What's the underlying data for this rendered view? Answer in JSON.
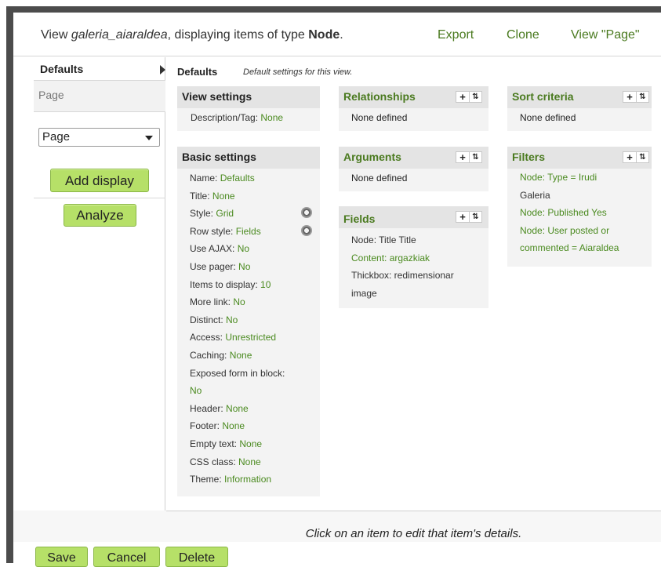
{
  "header": {
    "title_prefix": "View ",
    "view_name": "galeria_aiaraldea",
    "title_middle": ", displaying items of type ",
    "item_type": "Node",
    "title_suffix": ".",
    "links": {
      "export": "Export",
      "clone": "Clone",
      "view_page": "View \"Page\""
    }
  },
  "sidebar": {
    "tabs": {
      "defaults": "Defaults",
      "page": "Page"
    },
    "display_select": {
      "value": "Page"
    },
    "add_display_label": "Add display",
    "analyze_label": "Analyze"
  },
  "main": {
    "breadcrumb": {
      "title": "Defaults",
      "subtitle": "Default settings for this view."
    },
    "view_settings": {
      "title": "View settings",
      "items": [
        {
          "label": "Description/Tag: ",
          "value": "None"
        }
      ]
    },
    "basic_settings": {
      "title": "Basic settings",
      "items": [
        {
          "label": "Name: ",
          "value": "Defaults"
        },
        {
          "label": "Title: ",
          "value": "None"
        },
        {
          "label": "Style: ",
          "value": "Grid"
        },
        {
          "label": "Row style: ",
          "value": "Fields"
        },
        {
          "label": "Use AJAX: ",
          "value": "No"
        },
        {
          "label": "Use pager: ",
          "value": "No"
        },
        {
          "label": "Items to display: ",
          "value": "10"
        },
        {
          "label": "More link: ",
          "value": "No"
        },
        {
          "label": "Distinct: ",
          "value": "No"
        },
        {
          "label": "Access: ",
          "value": "Unrestricted"
        },
        {
          "label": "Caching: ",
          "value": "None"
        },
        {
          "label": "Exposed form in block:",
          "value": ""
        },
        {
          "label": "",
          "value": "No"
        },
        {
          "label": "Header: ",
          "value": "None"
        },
        {
          "label": "Footer: ",
          "value": "None"
        },
        {
          "label": "Empty text: ",
          "value": "None"
        },
        {
          "label": "CSS class: ",
          "value": "None"
        },
        {
          "label": "Theme: ",
          "value": "Information"
        }
      ]
    },
    "relationships": {
      "title": "Relationships",
      "items": [
        "None defined"
      ]
    },
    "arguments": {
      "title": "Arguments",
      "items": [
        "None defined"
      ]
    },
    "fields": {
      "title": "Fields",
      "items": [
        "Node: Title Title",
        "Content: argazkiak",
        "Thickbox: redimensionar",
        "image"
      ]
    },
    "sort_criteria": {
      "title": "Sort criteria",
      "items": [
        "None defined"
      ]
    },
    "filters": {
      "title": "Filters",
      "items": [
        "Node: Type = Irudi",
        "Galeria",
        "Node: Published Yes",
        "Node: User posted or",
        "commented = Aiaraldea"
      ]
    },
    "icons": {
      "add": "+",
      "rearrange": "⇅",
      "gear": "gear-icon"
    }
  },
  "footer": {
    "message": "Click on an item to edit that item's details.",
    "buttons": {
      "save": "Save",
      "cancel": "Cancel",
      "delete": "Delete"
    }
  },
  "colors": {
    "accent_green": "#4a7a1f",
    "button_green": "#b6e068",
    "frame": "#4c4c4c"
  }
}
